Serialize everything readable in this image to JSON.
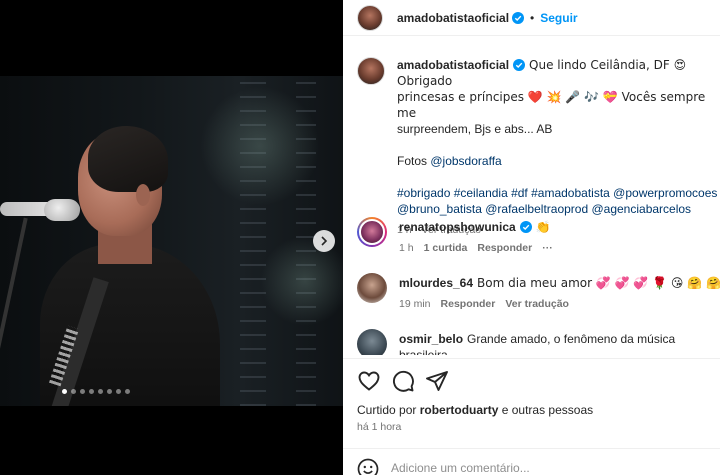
{
  "post": {
    "author": "amadobatistaoficial",
    "follow_label": "Seguir",
    "carousel": {
      "dot_count": 8,
      "active_index": 0
    }
  },
  "caption": {
    "username": "amadobatistaoficial",
    "line1": "Que lindo Ceilândia, DF 😍 Obrigado",
    "line2": "princesas e príncipes ❤️ 💥 🎤 🎶 💝 Vocês sempre me",
    "line3": "surpreendem, Bjs e abs... AB",
    "photos_prefix": "Fotos ",
    "photos_mention": "@jobsdoraffa",
    "tags_line1": "#obrigado #ceilandia #df #amadobatista @powerpromocoes",
    "tags_line2": "@bruno_batista @rafaelbeltraoprod @agenciabarcelos",
    "time": "1 h",
    "translate": "Ver tradução"
  },
  "comments": [
    {
      "username": "renatatopshowunica",
      "text": "👏",
      "time": "1 h",
      "likes": "1 curtida",
      "reply": "Responder",
      "more": "···"
    },
    {
      "username": "mlourdes_64",
      "text": "Bom dia meu amor 💞 💞 💞 🌹 😘 🤗 🤗",
      "time": "19 min",
      "reply": "Responder",
      "translate": "Ver tradução"
    },
    {
      "username": "osmir_belo",
      "text": "Grande amado, o fenômeno da música brasileira."
    }
  ],
  "footer": {
    "liked_prefix": "Curtido por ",
    "liked_user": "robertoduarty",
    "liked_suffix": " e outras pessoas",
    "time": "há 1 hora",
    "comment_placeholder": "Adicione um comentário..."
  },
  "icons": {
    "verified": "verified-badge-icon",
    "like": "heart-icon",
    "comment": "comment-icon",
    "share": "share-icon",
    "emoji": "emoji-icon",
    "next": "chevron-right-icon"
  },
  "colors": {
    "accent": "#0095f6",
    "verified": "#0095f6",
    "muted": "#737373",
    "link": "#00376b"
  }
}
